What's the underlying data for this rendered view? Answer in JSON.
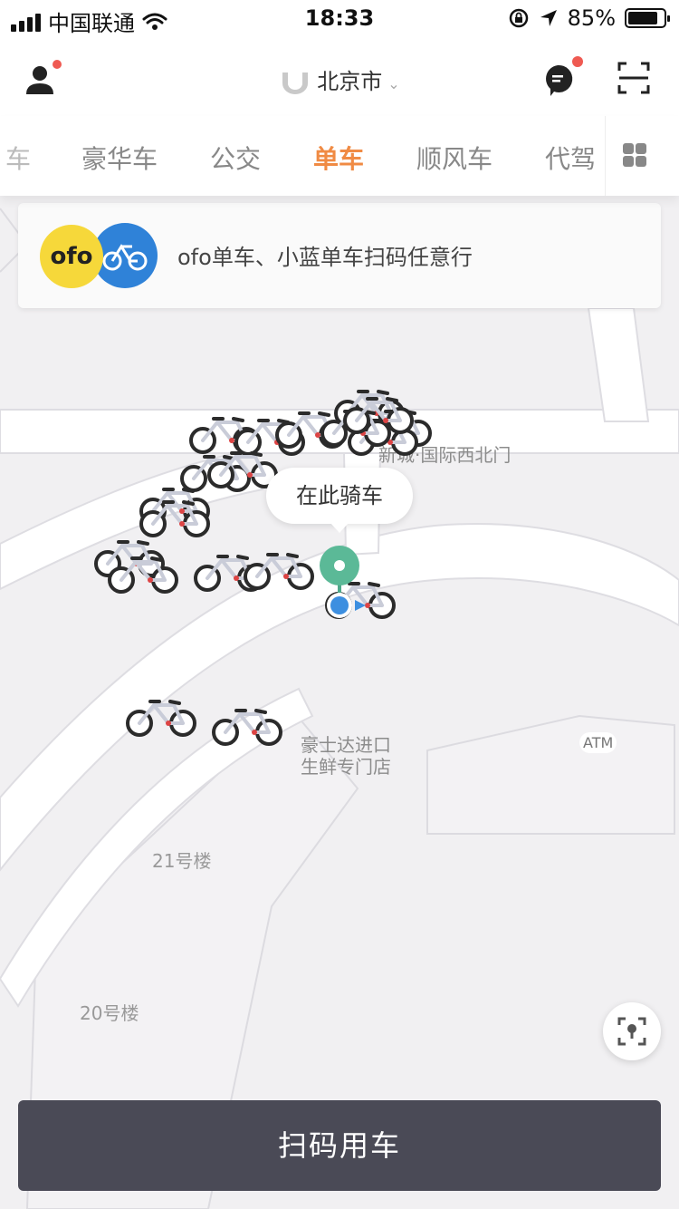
{
  "status_bar": {
    "carrier": "中国联通",
    "time": "18:33",
    "battery_percent": "85%",
    "battery_level": 0.85
  },
  "nav": {
    "city": "北京市",
    "avatar_icon": "user-icon",
    "message_icon": "chat-bubble-icon",
    "scan_icon": "scan-frame-icon"
  },
  "tabs": {
    "partial_left": "车",
    "items": [
      {
        "label": "豪华车",
        "active": false
      },
      {
        "label": "公交",
        "active": false
      },
      {
        "label": "单车",
        "active": true
      },
      {
        "label": "顺风车",
        "active": false
      },
      {
        "label": "代驾",
        "active": false
      }
    ],
    "accent_color": "#f08b44"
  },
  "banner": {
    "ofo_logo_text": "ofo",
    "text": "ofo单车、小蓝单车扫码任意行"
  },
  "map": {
    "labels": {
      "gate": "新城·国际西北门",
      "shop_line1": "豪士达进口",
      "shop_line2": "生鲜专门店",
      "atm": "ATM",
      "building21": "21号楼",
      "building20": "20号楼"
    },
    "callout": "在此骑车"
  },
  "actions": {
    "scan_button": "扫码用车",
    "scan_button_color": "#4a4a56"
  }
}
